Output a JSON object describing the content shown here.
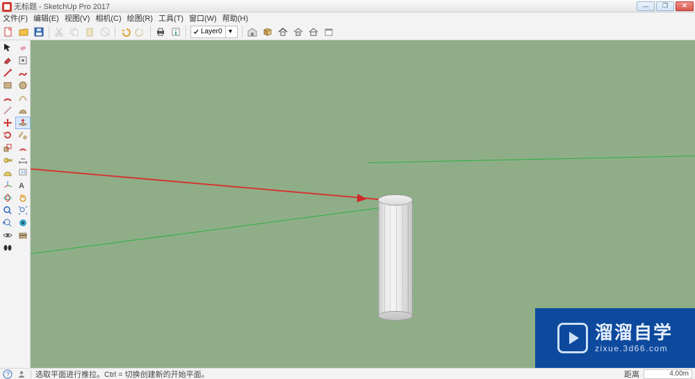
{
  "window": {
    "title": "无标题 - SketchUp Pro 2017"
  },
  "menu": {
    "file": "文件(F)",
    "edit": "编辑(E)",
    "view": "视图(V)",
    "camera": "相机(C)",
    "draw": "绘图(R)",
    "tools": "工具(T)",
    "window": "窗口(W)",
    "help": "帮助(H)"
  },
  "toolbar": {
    "new": "new-doc",
    "open": "open",
    "save": "save",
    "cut": "cut",
    "copy": "copy",
    "paste": "paste",
    "delete": "delete",
    "undo": "undo",
    "redo": "redo",
    "print": "print",
    "model_info": "model-info",
    "layer": {
      "visible": true,
      "name": "Layer0"
    },
    "warehouse": "warehouse",
    "add_loc": "add-location",
    "extensions": "extensions"
  },
  "status": {
    "hint": "选取平面进行推拉。Ctrl = 切换创建新的开始平面。",
    "distance_label": "距离",
    "distance_value": "4.00m"
  },
  "watermark": {
    "brand": "溜溜自学",
    "url": "zixue.3d66.com"
  }
}
